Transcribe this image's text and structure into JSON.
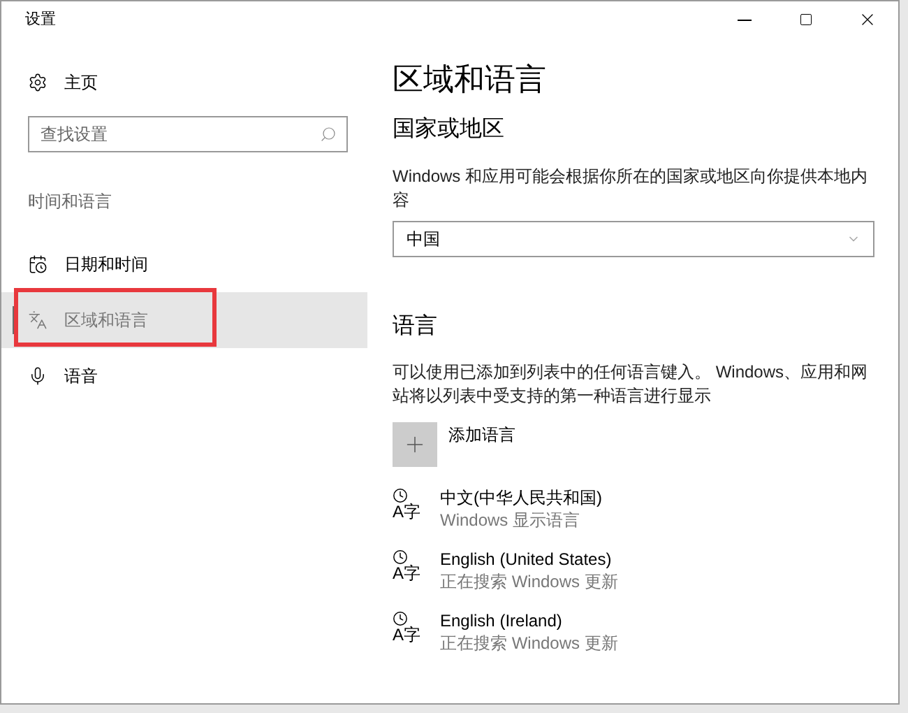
{
  "window": {
    "title": "设置"
  },
  "sidebar": {
    "home": "主页",
    "search": {
      "placeholder": "查找设置"
    },
    "section": "时间和语言",
    "items": [
      {
        "label": "日期和时间",
        "kind": "calendar",
        "selected": false,
        "annotated": false
      },
      {
        "label": "区域和语言",
        "kind": "region",
        "selected": true,
        "annotated": true
      },
      {
        "label": "语音",
        "kind": "mic",
        "selected": false,
        "annotated": false
      }
    ]
  },
  "page": {
    "title": "区域和语言",
    "region_heading": "国家或地区",
    "region_desc": "Windows 和应用可能会根据你所在的国家或地区向你提供本地内容",
    "region_select": "中国",
    "language_heading": "语言",
    "language_desc": "可以使用已添加到列表中的任何语言键入。 Windows、应用和网站将以列表中受支持的第一种语言进行显示",
    "add_language": "添加语言",
    "languages": [
      {
        "glyph": "A字",
        "name": "中文(中华人民共和国)",
        "status": "Windows 显示语言"
      },
      {
        "glyph": "A字",
        "name": "English (United States)",
        "status": "正在搜索 Windows 更新"
      },
      {
        "glyph": "A字",
        "name": "English (Ireland)",
        "status": "正在搜索 Windows 更新"
      }
    ]
  }
}
